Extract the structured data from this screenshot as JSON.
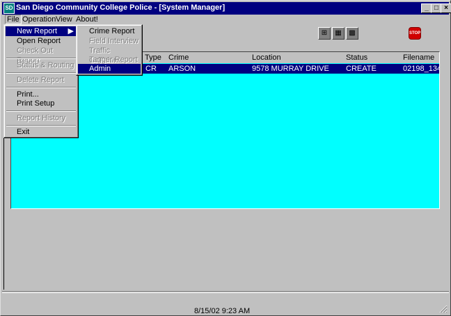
{
  "window": {
    "title": "San Diego Community College Police - [System Manager]",
    "icon_text": "SD"
  },
  "title_buttons": {
    "minimize": "_",
    "maximize": "□",
    "close": "×"
  },
  "menubar": [
    "File",
    "Operation",
    "View",
    "About!"
  ],
  "file_menu": [
    {
      "label": "New Report",
      "state": "highlighted",
      "submenu": true
    },
    {
      "label": "Open Report",
      "state": "enabled"
    },
    {
      "label": "Check Out Report",
      "state": "disabled"
    },
    {
      "label": "Status & Routing",
      "state": "disabled"
    },
    {
      "label": "Delete Report",
      "state": "disabled"
    },
    {
      "label": "Print...",
      "state": "enabled"
    },
    {
      "label": "Print Setup",
      "state": "enabled"
    },
    {
      "label": "Report History",
      "state": "disabled"
    },
    {
      "label": "Exit",
      "state": "enabled"
    }
  ],
  "submenu_arrow": "▶",
  "new_report_submenu": [
    {
      "label": "Crime Report",
      "state": "enabled"
    },
    {
      "label": "Field Interview",
      "state": "disabled"
    },
    {
      "label": "Traffic Collision",
      "state": "disabled"
    },
    {
      "label": "Tagger Report",
      "state": "disabled"
    },
    {
      "label": "Admin",
      "state": "highlighted"
    }
  ],
  "table": {
    "columns": [
      "Type",
      "Crime",
      "Location",
      "Status",
      "Filename"
    ],
    "rows": [
      {
        "type": "CR",
        "crime": "ARSON",
        "location": "9578 MURRAY DRIVE",
        "status": "CREATE",
        "filename": "02198_134"
      }
    ]
  },
  "statusbar": {
    "datetime": "8/15/02  9:23 AM"
  },
  "toolbar_icons": [
    "hierarchy-icon",
    "layers-icon",
    "grid-icon",
    "stop-icon"
  ],
  "stop_label": "STOP",
  "colors": {
    "title_bg": "#000080",
    "list_bg": "#00ffff",
    "selection": "#000080"
  }
}
